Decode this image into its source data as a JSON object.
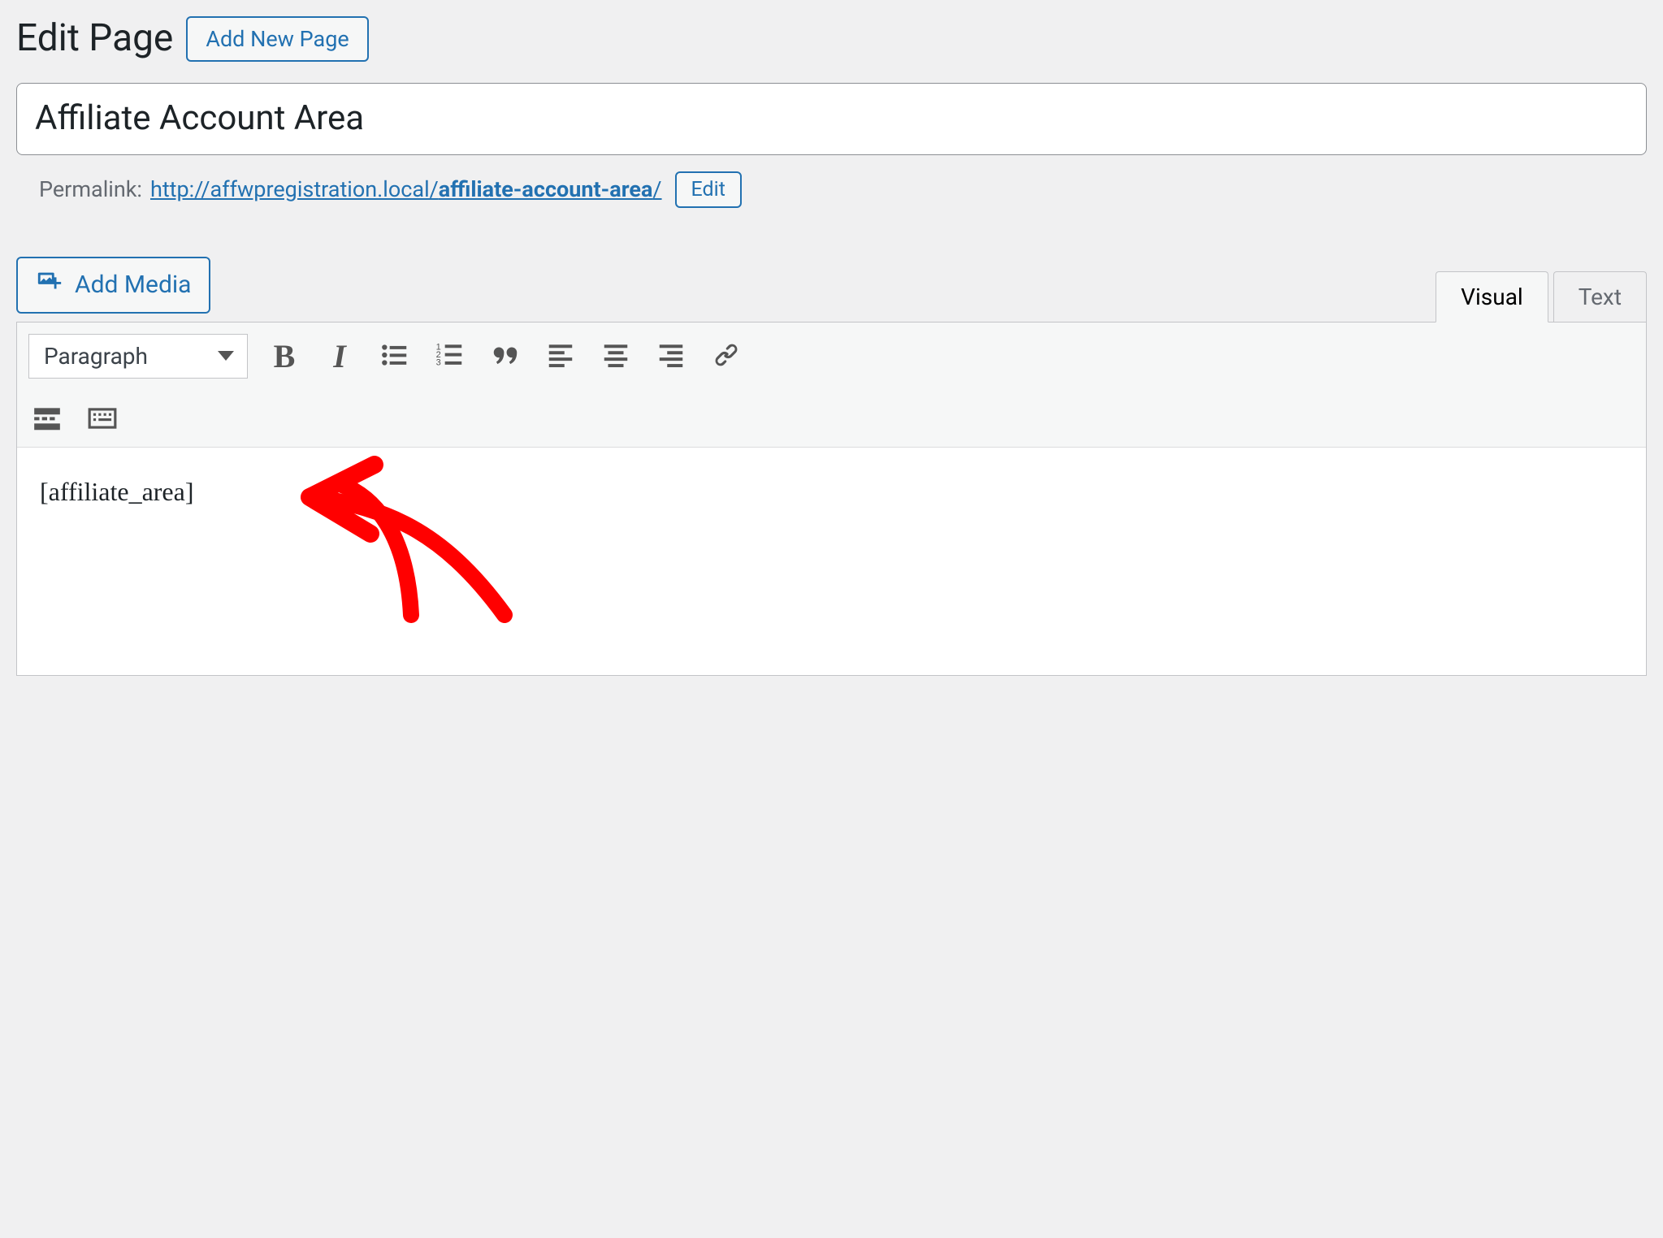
{
  "header": {
    "title": "Edit Page",
    "add_new_label": "Add New Page"
  },
  "title_field": {
    "value": "Affiliate Account Area"
  },
  "permalink": {
    "label": "Permalink:",
    "base": "http://affwpregistration.local/",
    "slug": "affiliate-account-area",
    "trailing": "/",
    "edit_label": "Edit"
  },
  "media": {
    "add_media_label": "Add Media"
  },
  "tabs": {
    "visual": "Visual",
    "text": "Text",
    "active": "visual"
  },
  "toolbar": {
    "format_label": "Paragraph",
    "buttons": {
      "bold": "B",
      "italic": "I"
    }
  },
  "content": {
    "body": "[affiliate_area]"
  }
}
